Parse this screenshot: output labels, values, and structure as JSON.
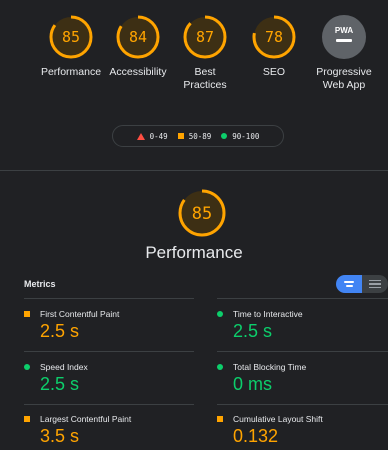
{
  "colors": {
    "fail": "#ff4e42",
    "average": "#ffa400",
    "pass": "#0cce6b",
    "background": "#202124",
    "accent": "#4285f4"
  },
  "categories": [
    {
      "score": "85",
      "fraction": 0.85,
      "label": "Performance"
    },
    {
      "score": "84",
      "fraction": 0.84,
      "label": "Accessibility"
    },
    {
      "score": "87",
      "fraction": 0.87,
      "label": "Best\nPractices"
    },
    {
      "score": "78",
      "fraction": 0.78,
      "label": "SEO"
    },
    {
      "badge": "PWA",
      "label": "Progressive\nWeb App"
    }
  ],
  "legend": {
    "fail": "0-49",
    "average": "50-89",
    "pass": "90-100"
  },
  "section": {
    "score": "85",
    "fraction": 0.85,
    "title": "Performance",
    "metrics_header": "Metrics"
  },
  "metrics": [
    {
      "name": "First Contentful Paint",
      "value": "2.5 s",
      "status": "average"
    },
    {
      "name": "Time to Interactive",
      "value": "2.5 s",
      "status": "pass"
    },
    {
      "name": "Speed Index",
      "value": "2.5 s",
      "status": "pass"
    },
    {
      "name": "Total Blocking Time",
      "value": "0 ms",
      "status": "pass"
    },
    {
      "name": "Largest Contentful Paint",
      "value": "3.5 s",
      "status": "average"
    },
    {
      "name": "Cumulative Layout Shift",
      "value": "0.132",
      "status": "average"
    }
  ]
}
